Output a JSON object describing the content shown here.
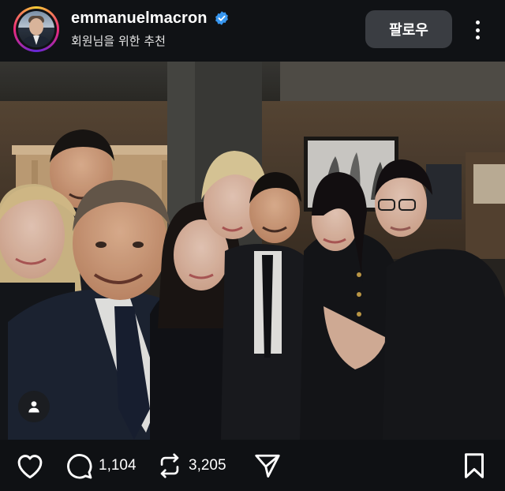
{
  "header": {
    "username": "emmanuelmacron",
    "verified": true,
    "subtitle": "회원님을 위한 추천",
    "follow_label": "팔로우",
    "more_icon": "more-vertical-icon"
  },
  "post": {
    "image_description_icon": "photo",
    "overlay_icon": "person-icon"
  },
  "actions": {
    "like_icon": "heart-icon",
    "comment_icon": "comment-icon",
    "comment_count": "1,104",
    "repost_icon": "repost-icon",
    "repost_count": "3,205",
    "share_icon": "send-icon",
    "save_icon": "bookmark-icon"
  },
  "colors": {
    "background": "#0f1114",
    "follow_button": "#3a3d42",
    "verified": "#3897f0"
  }
}
